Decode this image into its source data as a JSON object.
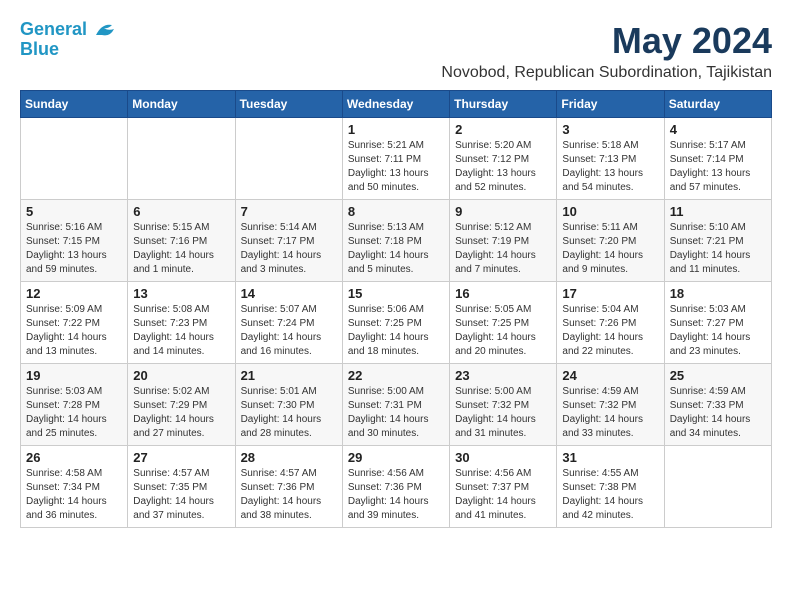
{
  "logo": {
    "line1": "General",
    "line2": "Blue"
  },
  "title": "May 2024",
  "location": "Novobod, Republican Subordination, Tajikistan",
  "weekdays": [
    "Sunday",
    "Monday",
    "Tuesday",
    "Wednesday",
    "Thursday",
    "Friday",
    "Saturday"
  ],
  "weeks": [
    [
      {
        "day": "",
        "sunrise": "",
        "sunset": "",
        "daylight": ""
      },
      {
        "day": "",
        "sunrise": "",
        "sunset": "",
        "daylight": ""
      },
      {
        "day": "",
        "sunrise": "",
        "sunset": "",
        "daylight": ""
      },
      {
        "day": "1",
        "sunrise": "Sunrise: 5:21 AM",
        "sunset": "Sunset: 7:11 PM",
        "daylight": "Daylight: 13 hours and 50 minutes."
      },
      {
        "day": "2",
        "sunrise": "Sunrise: 5:20 AM",
        "sunset": "Sunset: 7:12 PM",
        "daylight": "Daylight: 13 hours and 52 minutes."
      },
      {
        "day": "3",
        "sunrise": "Sunrise: 5:18 AM",
        "sunset": "Sunset: 7:13 PM",
        "daylight": "Daylight: 13 hours and 54 minutes."
      },
      {
        "day": "4",
        "sunrise": "Sunrise: 5:17 AM",
        "sunset": "Sunset: 7:14 PM",
        "daylight": "Daylight: 13 hours and 57 minutes."
      }
    ],
    [
      {
        "day": "5",
        "sunrise": "Sunrise: 5:16 AM",
        "sunset": "Sunset: 7:15 PM",
        "daylight": "Daylight: 13 hours and 59 minutes."
      },
      {
        "day": "6",
        "sunrise": "Sunrise: 5:15 AM",
        "sunset": "Sunset: 7:16 PM",
        "daylight": "Daylight: 14 hours and 1 minute."
      },
      {
        "day": "7",
        "sunrise": "Sunrise: 5:14 AM",
        "sunset": "Sunset: 7:17 PM",
        "daylight": "Daylight: 14 hours and 3 minutes."
      },
      {
        "day": "8",
        "sunrise": "Sunrise: 5:13 AM",
        "sunset": "Sunset: 7:18 PM",
        "daylight": "Daylight: 14 hours and 5 minutes."
      },
      {
        "day": "9",
        "sunrise": "Sunrise: 5:12 AM",
        "sunset": "Sunset: 7:19 PM",
        "daylight": "Daylight: 14 hours and 7 minutes."
      },
      {
        "day": "10",
        "sunrise": "Sunrise: 5:11 AM",
        "sunset": "Sunset: 7:20 PM",
        "daylight": "Daylight: 14 hours and 9 minutes."
      },
      {
        "day": "11",
        "sunrise": "Sunrise: 5:10 AM",
        "sunset": "Sunset: 7:21 PM",
        "daylight": "Daylight: 14 hours and 11 minutes."
      }
    ],
    [
      {
        "day": "12",
        "sunrise": "Sunrise: 5:09 AM",
        "sunset": "Sunset: 7:22 PM",
        "daylight": "Daylight: 14 hours and 13 minutes."
      },
      {
        "day": "13",
        "sunrise": "Sunrise: 5:08 AM",
        "sunset": "Sunset: 7:23 PM",
        "daylight": "Daylight: 14 hours and 14 minutes."
      },
      {
        "day": "14",
        "sunrise": "Sunrise: 5:07 AM",
        "sunset": "Sunset: 7:24 PM",
        "daylight": "Daylight: 14 hours and 16 minutes."
      },
      {
        "day": "15",
        "sunrise": "Sunrise: 5:06 AM",
        "sunset": "Sunset: 7:25 PM",
        "daylight": "Daylight: 14 hours and 18 minutes."
      },
      {
        "day": "16",
        "sunrise": "Sunrise: 5:05 AM",
        "sunset": "Sunset: 7:25 PM",
        "daylight": "Daylight: 14 hours and 20 minutes."
      },
      {
        "day": "17",
        "sunrise": "Sunrise: 5:04 AM",
        "sunset": "Sunset: 7:26 PM",
        "daylight": "Daylight: 14 hours and 22 minutes."
      },
      {
        "day": "18",
        "sunrise": "Sunrise: 5:03 AM",
        "sunset": "Sunset: 7:27 PM",
        "daylight": "Daylight: 14 hours and 23 minutes."
      }
    ],
    [
      {
        "day": "19",
        "sunrise": "Sunrise: 5:03 AM",
        "sunset": "Sunset: 7:28 PM",
        "daylight": "Daylight: 14 hours and 25 minutes."
      },
      {
        "day": "20",
        "sunrise": "Sunrise: 5:02 AM",
        "sunset": "Sunset: 7:29 PM",
        "daylight": "Daylight: 14 hours and 27 minutes."
      },
      {
        "day": "21",
        "sunrise": "Sunrise: 5:01 AM",
        "sunset": "Sunset: 7:30 PM",
        "daylight": "Daylight: 14 hours and 28 minutes."
      },
      {
        "day": "22",
        "sunrise": "Sunrise: 5:00 AM",
        "sunset": "Sunset: 7:31 PM",
        "daylight": "Daylight: 14 hours and 30 minutes."
      },
      {
        "day": "23",
        "sunrise": "Sunrise: 5:00 AM",
        "sunset": "Sunset: 7:32 PM",
        "daylight": "Daylight: 14 hours and 31 minutes."
      },
      {
        "day": "24",
        "sunrise": "Sunrise: 4:59 AM",
        "sunset": "Sunset: 7:32 PM",
        "daylight": "Daylight: 14 hours and 33 minutes."
      },
      {
        "day": "25",
        "sunrise": "Sunrise: 4:59 AM",
        "sunset": "Sunset: 7:33 PM",
        "daylight": "Daylight: 14 hours and 34 minutes."
      }
    ],
    [
      {
        "day": "26",
        "sunrise": "Sunrise: 4:58 AM",
        "sunset": "Sunset: 7:34 PM",
        "daylight": "Daylight: 14 hours and 36 minutes."
      },
      {
        "day": "27",
        "sunrise": "Sunrise: 4:57 AM",
        "sunset": "Sunset: 7:35 PM",
        "daylight": "Daylight: 14 hours and 37 minutes."
      },
      {
        "day": "28",
        "sunrise": "Sunrise: 4:57 AM",
        "sunset": "Sunset: 7:36 PM",
        "daylight": "Daylight: 14 hours and 38 minutes."
      },
      {
        "day": "29",
        "sunrise": "Sunrise: 4:56 AM",
        "sunset": "Sunset: 7:36 PM",
        "daylight": "Daylight: 14 hours and 39 minutes."
      },
      {
        "day": "30",
        "sunrise": "Sunrise: 4:56 AM",
        "sunset": "Sunset: 7:37 PM",
        "daylight": "Daylight: 14 hours and 41 minutes."
      },
      {
        "day": "31",
        "sunrise": "Sunrise: 4:55 AM",
        "sunset": "Sunset: 7:38 PM",
        "daylight": "Daylight: 14 hours and 42 minutes."
      },
      {
        "day": "",
        "sunrise": "",
        "sunset": "",
        "daylight": ""
      }
    ]
  ]
}
